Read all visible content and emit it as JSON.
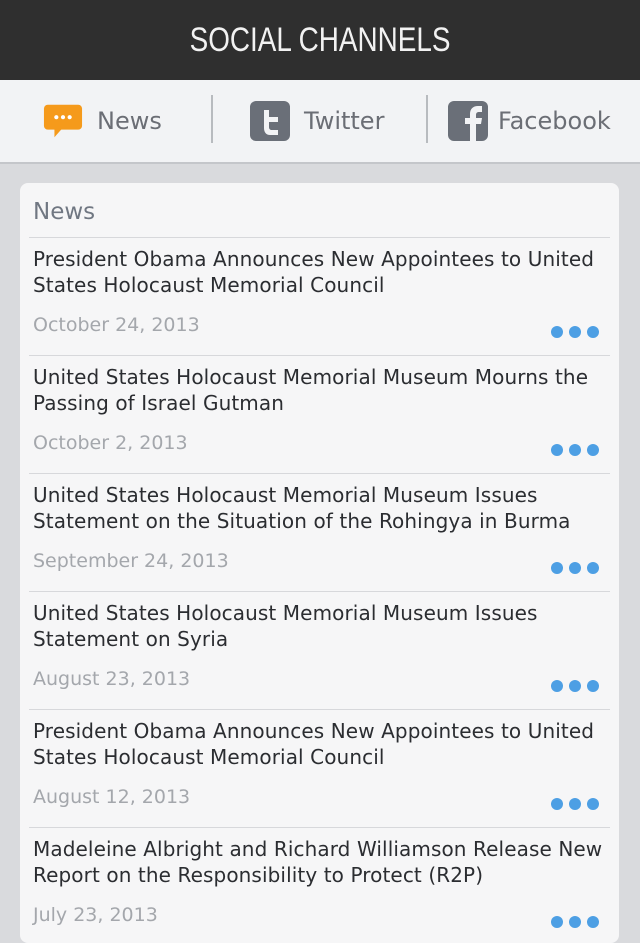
{
  "header": {
    "title": "SOCIAL CHANNELS"
  },
  "tabs": [
    {
      "label": "News",
      "icon": "speech-bubble-icon",
      "color": "#f59a1b"
    },
    {
      "label": "Twitter",
      "icon": "twitter-icon",
      "color": "#6a6f78"
    },
    {
      "label": "Facebook",
      "icon": "facebook-icon",
      "color": "#6a6f78"
    }
  ],
  "card": {
    "title": "News",
    "items": [
      {
        "headline": "President Obama Announces New Appointees to United States Holocaust Memorial Council",
        "date": "October 24, 2013"
      },
      {
        "headline": "United States Holocaust Memorial Museum Mourns the Passing of Israel Gutman",
        "date": "October 2, 2013"
      },
      {
        "headline": "United States Holocaust Memorial Museum Issues Statement on the Situation of the Rohingya in Burma",
        "date": "September 24, 2013"
      },
      {
        "headline": "United States Holocaust Memorial Museum Issues Statement on Syria",
        "date": "August 23, 2013"
      },
      {
        "headline": "President Obama Announces New Appointees to United States Holocaust Memorial Council",
        "date": "August 12, 2013"
      },
      {
        "headline": "Madeleine Albright and Richard Williamson Release New Report on the Responsibility to Protect (R2P)",
        "date": "July 23, 2013"
      }
    ]
  },
  "colors": {
    "header_bg": "#2f2f2f",
    "accent_dots": "#4d9fe4",
    "news_icon": "#f59a1b"
  }
}
